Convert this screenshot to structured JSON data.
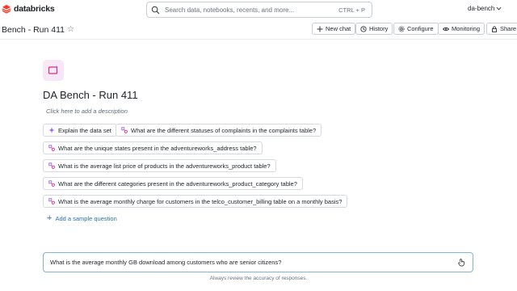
{
  "header": {
    "logo_text": "databricks",
    "search_placeholder": "Search data, notebooks, recents, and more...",
    "search_shortcut": "CTRL + P",
    "workspace_name": "da-bench"
  },
  "titlebar": {
    "title": "Bench - Run 411",
    "buttons": {
      "new_chat": "New chat",
      "history": "History",
      "configure": "Configure",
      "monitoring": "Monitoring",
      "share": "Share"
    }
  },
  "space": {
    "title": "DA Bench - Run 411",
    "description_placeholder": "Click here to add a description"
  },
  "suggestions": {
    "explain": "Explain the data set",
    "q1": "What are the different statuses of complaints in the complaints table?",
    "q2": "What are the unique states present in the adventureworks_address table?",
    "q3": "What is the average list price of products in the adventureworks_product table?",
    "q4": "What are the different categories present in the adventureworks_product_category table?",
    "q5": "What is the average monthly charge for customers in the telco_customer_billing table on a monthly basis?"
  },
  "add_sample_question": "Add a sample question",
  "chat": {
    "input_value": "What is the average monthly GB download among customers who are senior citizens?"
  },
  "footnote": "Always review the accuracy of responses.",
  "colors": {
    "brand": "#ff3621",
    "link": "#2272b4",
    "accent_purple": "#9b5de5",
    "focus_border": "#7fb3d9"
  },
  "icons": {
    "logo": "databricks-logo-icon",
    "search": "search-icon",
    "chevron": "chevron-down-icon",
    "star": "star-icon",
    "plus": "plus-icon",
    "history": "history-icon",
    "configure": "gear-icon",
    "monitoring": "eye-icon",
    "share": "lock-icon",
    "space": "genie-space-icon",
    "sparkle": "sparkle-icon",
    "question": "shapes-icon",
    "send": "send-icon"
  }
}
